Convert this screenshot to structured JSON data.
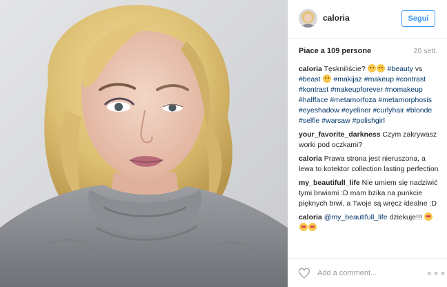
{
  "header": {
    "username": "caloria",
    "follow_label": "Segui",
    "avatar_icon": "profile-avatar"
  },
  "stats": {
    "likes": "Piace a 109 persone",
    "date": "20 sett."
  },
  "caption": {
    "author": "caloria",
    "text_parts": [
      {
        "type": "text",
        "value": "Tęskniliście? "
      },
      {
        "type": "emoji",
        "value": "grinning-face"
      },
      {
        "type": "emoji",
        "value": "grinning-face"
      },
      {
        "type": "text",
        "value": " "
      },
      {
        "type": "tag",
        "value": "#beauty"
      },
      {
        "type": "text",
        "value": " vs "
      },
      {
        "type": "tag",
        "value": "#beast"
      },
      {
        "type": "text",
        "value": " "
      },
      {
        "type": "emoji",
        "value": "grimacing-face"
      },
      {
        "type": "text",
        "value": " "
      },
      {
        "type": "tag",
        "value": "#makijaz"
      },
      {
        "type": "text",
        "value": " "
      },
      {
        "type": "tag",
        "value": "#makeup"
      },
      {
        "type": "text",
        "value": " "
      },
      {
        "type": "tag",
        "value": "#contrast"
      },
      {
        "type": "text",
        "value": " "
      },
      {
        "type": "tag",
        "value": "#kontrast"
      },
      {
        "type": "text",
        "value": " "
      },
      {
        "type": "tag",
        "value": "#makeupforever"
      },
      {
        "type": "text",
        "value": " "
      },
      {
        "type": "tag",
        "value": "#nomakeup"
      },
      {
        "type": "text",
        "value": " "
      },
      {
        "type": "tag",
        "value": "#halfface"
      },
      {
        "type": "text",
        "value": " "
      },
      {
        "type": "tag",
        "value": "#metamorfoza"
      },
      {
        "type": "text",
        "value": " "
      },
      {
        "type": "tag",
        "value": "#metamorphosis"
      },
      {
        "type": "text",
        "value": " "
      },
      {
        "type": "tag",
        "value": "#eyeshadow"
      },
      {
        "type": "text",
        "value": " "
      },
      {
        "type": "tag",
        "value": "#eyeliner"
      },
      {
        "type": "text",
        "value": " "
      },
      {
        "type": "tag",
        "value": "#curlyhair"
      },
      {
        "type": "text",
        "value": " "
      },
      {
        "type": "tag",
        "value": "#blonde"
      },
      {
        "type": "text",
        "value": " "
      },
      {
        "type": "tag",
        "value": "#selfie"
      },
      {
        "type": "text",
        "value": " "
      },
      {
        "type": "tag",
        "value": "#warsaw"
      },
      {
        "type": "text",
        "value": " "
      },
      {
        "type": "tag",
        "value": "#polishgirl"
      }
    ]
  },
  "comments": [
    {
      "author": "your_favorite_darkness",
      "text_parts": [
        {
          "type": "text",
          "value": "Czym zakrywasz worki pod oczkami?"
        }
      ]
    },
    {
      "author": "caloria",
      "text_parts": [
        {
          "type": "text",
          "value": "Prawa strona jest nieruszona, a lewa to kotektor collection lasting perfection"
        }
      ]
    },
    {
      "author": "my_beautifull_life",
      "text_parts": [
        {
          "type": "text",
          "value": "Nie umiem się nadziwić tymi brwiami :D mam bzika na punkcie pięknych brwi, a Twoje są wręcz idealne :D"
        }
      ]
    },
    {
      "author": "caloria",
      "text_parts": [
        {
          "type": "tag",
          "value": "@my_beautifull_life"
        },
        {
          "type": "text",
          "value": " dziekuje!!! "
        },
        {
          "type": "emoji",
          "value": "heart-eyes-face"
        },
        {
          "type": "emoji",
          "value": "heart-eyes-face"
        },
        {
          "type": "emoji",
          "value": "heart-eyes-face"
        }
      ]
    }
  ],
  "footer": {
    "comment_placeholder": "Add a comment...",
    "like_icon": "heart-outline-icon",
    "more_label": "∘∘∘"
  },
  "colors": {
    "accent": "#3897f0",
    "tag": "#003569",
    "muted": "#999999",
    "border": "#efefef",
    "text": "#262626"
  }
}
